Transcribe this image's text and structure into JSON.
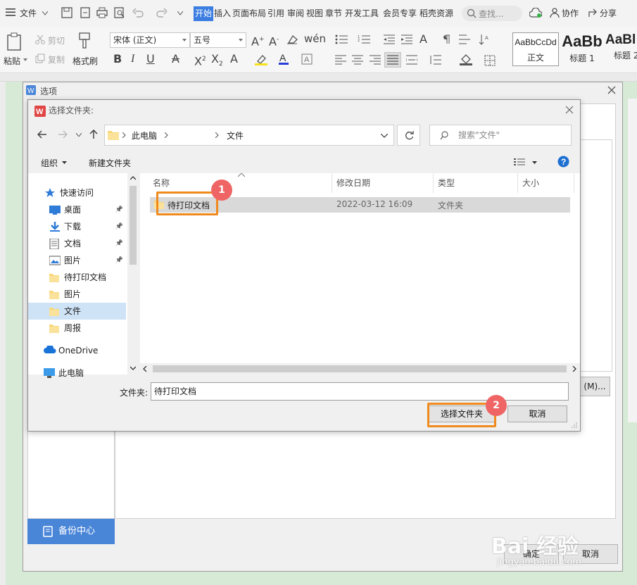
{
  "menubar": {
    "file_label": "文件",
    "tabs": [
      "开始",
      "插入",
      "页面布局",
      "引用",
      "审阅",
      "视图",
      "章节",
      "开发工具",
      "会员专享",
      "稻壳资源"
    ],
    "active_tab": "开始",
    "search_label": "查找...",
    "collab_label": "协作",
    "share_label": "分享"
  },
  "toolbar": {
    "paste_label": "粘贴",
    "cut_label": "剪切",
    "copy_label": "复制",
    "format_painter_label": "格式刷",
    "font_name": "宋体 (正文)",
    "font_size": "五号",
    "styles": [
      {
        "sample": "AaBbCcDd",
        "caption": "正文"
      },
      {
        "sample": "AaBb",
        "caption": "标题 1"
      },
      {
        "sample": "AaBl",
        "caption": "标题 2"
      }
    ]
  },
  "options_dialog": {
    "title": "选项",
    "backup_label": "备份中心",
    "ok_label": "确定",
    "cancel_label": "取消",
    "side_button_label": "(M)..."
  },
  "folder_dialog": {
    "title": "选择文件夹:",
    "breadcrumb": [
      "此电脑",
      "文件"
    ],
    "search_placeholder": "搜索\"文件\"",
    "organize_label": "组织",
    "new_folder_label": "新建文件夹",
    "nav_items": [
      {
        "label": "快速访问",
        "icon": "star-icon",
        "pinned": false
      },
      {
        "label": "桌面",
        "icon": "desktop-icon",
        "pinned": true
      },
      {
        "label": "下载",
        "icon": "download-icon",
        "pinned": true
      },
      {
        "label": "文档",
        "icon": "document-icon",
        "pinned": true
      },
      {
        "label": "图片",
        "icon": "picture-icon",
        "pinned": true
      },
      {
        "label": "待打印文档",
        "icon": "folder-icon",
        "pinned": false
      },
      {
        "label": "图片",
        "icon": "folder-icon",
        "pinned": false
      },
      {
        "label": "文件",
        "icon": "folder-icon",
        "pinned": false
      },
      {
        "label": "周报",
        "icon": "folder-icon",
        "pinned": false
      },
      {
        "label": "OneDrive",
        "icon": "cloud-icon",
        "pinned": false
      },
      {
        "label": "此电脑",
        "icon": "computer-icon",
        "pinned": false
      }
    ],
    "selected_nav": "文件",
    "columns": [
      "名称",
      "修改日期",
      "类型",
      "大小"
    ],
    "files": [
      {
        "name": "待打印文档",
        "modified": "2022-03-12 16:09",
        "type": "文件夹",
        "size": ""
      }
    ],
    "folder_field_label": "文件夹:",
    "folder_field_value": "待打印文档",
    "select_button_label": "选择文件夹",
    "cancel_button_label": "取消",
    "highlight_color": "#f08a1c",
    "badge_color": "#ef6464",
    "badges": [
      "1",
      "2"
    ]
  },
  "watermark": {
    "text": "Bai 经验",
    "url_text": "jingyan.baidu.com"
  }
}
